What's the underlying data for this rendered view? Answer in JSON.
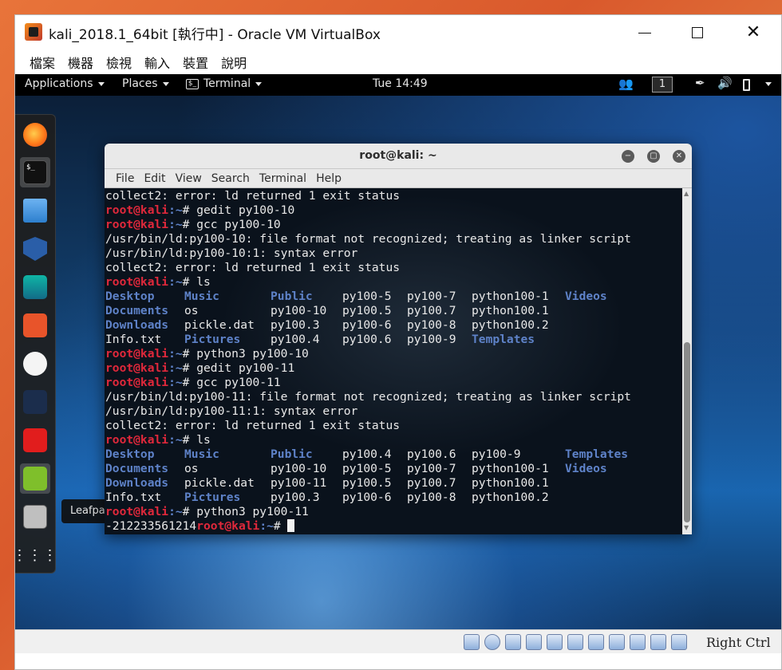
{
  "vbox": {
    "title": "kali_2018.1_64bit [執行中] - Oracle VM VirtualBox",
    "menu": [
      "檔案",
      "機器",
      "檢視",
      "輸入",
      "裝置",
      "說明"
    ],
    "statusbar": {
      "host_key": "Right Ctrl"
    }
  },
  "topbar": {
    "applications": "Applications",
    "places": "Places",
    "terminal": "Terminal",
    "terminal_icon": "$_",
    "clock": "Tue 14:49",
    "workspace": "1"
  },
  "dock": {
    "items": [
      "firefox-icon",
      "terminal-icon",
      "files-icon",
      "metasploit-icon",
      "armitage-icon",
      "burpsuite-icon",
      "maltego-icon",
      "beef-icon",
      "faraday-icon",
      "leafpad-icon",
      "keyboard-icon",
      "show-applications-icon"
    ],
    "terminal_glyph": "$_",
    "tooltip": "Leafpad"
  },
  "terminal": {
    "title": "root@kali: ~",
    "menu": [
      "File",
      "Edit",
      "View",
      "Search",
      "Terminal",
      "Help"
    ],
    "prompt_user": "root@kali",
    "prompt_path": ":~",
    "prompt_symbol": "# ",
    "lines": [
      {
        "type": "out",
        "text": "collect2: error: ld returned 1 exit status"
      },
      {
        "type": "cmd",
        "text": "gedit py100-10"
      },
      {
        "type": "cmd",
        "text": "gcc py100-10"
      },
      {
        "type": "out",
        "text": "/usr/bin/ld:py100-10: file format not recognized; treating as linker script"
      },
      {
        "type": "out",
        "text": "/usr/bin/ld:py100-10:1: syntax error"
      },
      {
        "type": "out",
        "text": "collect2: error: ld returned 1 exit status"
      },
      {
        "type": "cmd",
        "text": "ls"
      },
      {
        "type": "ls",
        "cells": [
          [
            "Desktop",
            true
          ],
          [
            "Music",
            true
          ],
          [
            "Public",
            true
          ],
          [
            "py100-5",
            false
          ],
          [
            "py100-7",
            false
          ],
          [
            "python100-1",
            false
          ],
          [
            "Videos",
            true
          ]
        ]
      },
      {
        "type": "ls",
        "cells": [
          [
            "Documents",
            true
          ],
          [
            "os",
            false
          ],
          [
            "py100-10",
            false
          ],
          [
            "py100.5",
            false
          ],
          [
            "py100.7",
            false
          ],
          [
            "python100.1",
            false
          ],
          [
            "",
            false
          ]
        ]
      },
      {
        "type": "ls",
        "cells": [
          [
            "Downloads",
            true
          ],
          [
            "pickle.dat",
            false
          ],
          [
            "py100.3",
            false
          ],
          [
            "py100-6",
            false
          ],
          [
            "py100-8",
            false
          ],
          [
            "python100.2",
            false
          ],
          [
            "",
            false
          ]
        ]
      },
      {
        "type": "ls",
        "cells": [
          [
            "Info.txt",
            false
          ],
          [
            "Pictures",
            true
          ],
          [
            "py100.4",
            false
          ],
          [
            "py100.6",
            false
          ],
          [
            "py100-9",
            false
          ],
          [
            "Templates",
            true
          ],
          [
            "",
            false
          ]
        ]
      },
      {
        "type": "cmd",
        "text": "python3 py100-10"
      },
      {
        "type": "cmd",
        "text": "gedit py100-11"
      },
      {
        "type": "cmd",
        "text": "gcc py100-11"
      },
      {
        "type": "out",
        "text": "/usr/bin/ld:py100-11: file format not recognized; treating as linker script"
      },
      {
        "type": "out",
        "text": "/usr/bin/ld:py100-11:1: syntax error"
      },
      {
        "type": "out",
        "text": "collect2: error: ld returned 1 exit status"
      },
      {
        "type": "cmd",
        "text": "ls"
      },
      {
        "type": "ls",
        "cells": [
          [
            "Desktop",
            true
          ],
          [
            "Music",
            true
          ],
          [
            "Public",
            true
          ],
          [
            "py100.4",
            false
          ],
          [
            "py100.6",
            false
          ],
          [
            "py100-9",
            false
          ],
          [
            "Templates",
            true
          ]
        ]
      },
      {
        "type": "ls",
        "cells": [
          [
            "Documents",
            true
          ],
          [
            "os",
            false
          ],
          [
            "py100-10",
            false
          ],
          [
            "py100-5",
            false
          ],
          [
            "py100-7",
            false
          ],
          [
            "python100-1",
            false
          ],
          [
            "Videos",
            true
          ]
        ]
      },
      {
        "type": "ls",
        "cells": [
          [
            "Downloads",
            true
          ],
          [
            "pickle.dat",
            false
          ],
          [
            "py100-11",
            false
          ],
          [
            "py100.5",
            false
          ],
          [
            "py100.7",
            false
          ],
          [
            "python100.1",
            false
          ],
          [
            "",
            false
          ]
        ]
      },
      {
        "type": "ls",
        "cells": [
          [
            "Info.txt",
            false
          ],
          [
            "Pictures",
            true
          ],
          [
            "py100.3",
            false
          ],
          [
            "py100-6",
            false
          ],
          [
            "py100-8",
            false
          ],
          [
            "python100.2",
            false
          ],
          [
            "",
            false
          ]
        ]
      },
      {
        "type": "cmd",
        "text": "python3 py100-11"
      },
      {
        "type": "final",
        "pre": "-212233561214",
        "text": ""
      }
    ]
  }
}
